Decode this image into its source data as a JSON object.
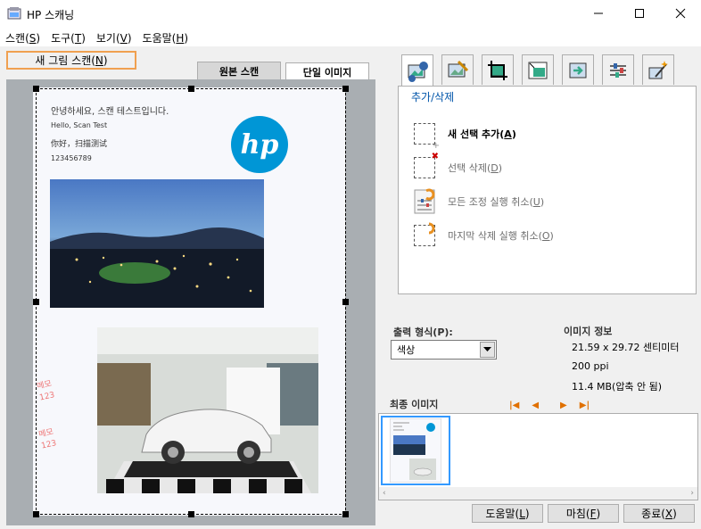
{
  "window": {
    "title": "HP 스캐닝",
    "minimize": "—",
    "maximize": "☐",
    "close": "✕"
  },
  "menu": [
    {
      "label": "스캔(",
      "key": "S",
      "end": ")"
    },
    {
      "label": "도구(",
      "key": "T",
      "end": ")"
    },
    {
      "label": "보기(",
      "key": "V",
      "end": ")"
    },
    {
      "label": "도움말(",
      "key": "H",
      "end": ")"
    }
  ],
  "new_scan_button": {
    "label": "새 그림 스캔(",
    "key": "N",
    "end": ")"
  },
  "tabs": {
    "original": "원본 스캔",
    "single": "단일 이미지"
  },
  "document": {
    "line1": "안녕하세요, 스캔 테스트입니다.",
    "line2": "Hello, Scan Test",
    "line3": "你好，扫描测试",
    "line4": "123456789",
    "logo": "hp",
    "notes": [
      "메모",
      "123",
      "메모",
      "123"
    ]
  },
  "tool_tabs": [
    "add-remove-tool-icon",
    "adjust-tool-icon",
    "crop-tool-icon",
    "resize-tool-icon",
    "send-tool-icon",
    "settings-tool-icon",
    "enhance-tool-icon"
  ],
  "panel": {
    "title": "추가/삭제",
    "items": [
      {
        "label": "새 선택 추가(",
        "key": "A",
        "end": ")",
        "enabled": true
      },
      {
        "label": "선택 삭제(",
        "key": "D",
        "end": ")",
        "enabled": false
      },
      {
        "label": "모든 조정 실행 취소(",
        "key": "U",
        "end": ")",
        "enabled": false
      },
      {
        "label": "마지막 삭제 실행 취소(",
        "key": "O",
        "end": ")",
        "enabled": false
      }
    ]
  },
  "output": {
    "label": "출력 형식(P):",
    "selected": "색상"
  },
  "image_info": {
    "title": "이미지 정보",
    "size": "21.59 x 29.72 센티미터",
    "resolution": "200 ppi",
    "filesize": "11.4 MB(압축 안 됨)"
  },
  "final_images": {
    "label": "최종 이미지",
    "nav": [
      "|◀",
      "◀",
      "▶",
      "▶|"
    ]
  },
  "bottom_buttons": [
    {
      "label": "도움말(",
      "key": "L",
      "end": ")"
    },
    {
      "label": "마침(",
      "key": "F",
      "end": ")"
    },
    {
      "label": "종료(",
      "key": "X",
      "end": ")"
    }
  ],
  "colors": {
    "accent": "#3399ff",
    "hp_blue": "#0096d6",
    "panel_title": "#0055aa",
    "nav_orange": "#e07000"
  }
}
